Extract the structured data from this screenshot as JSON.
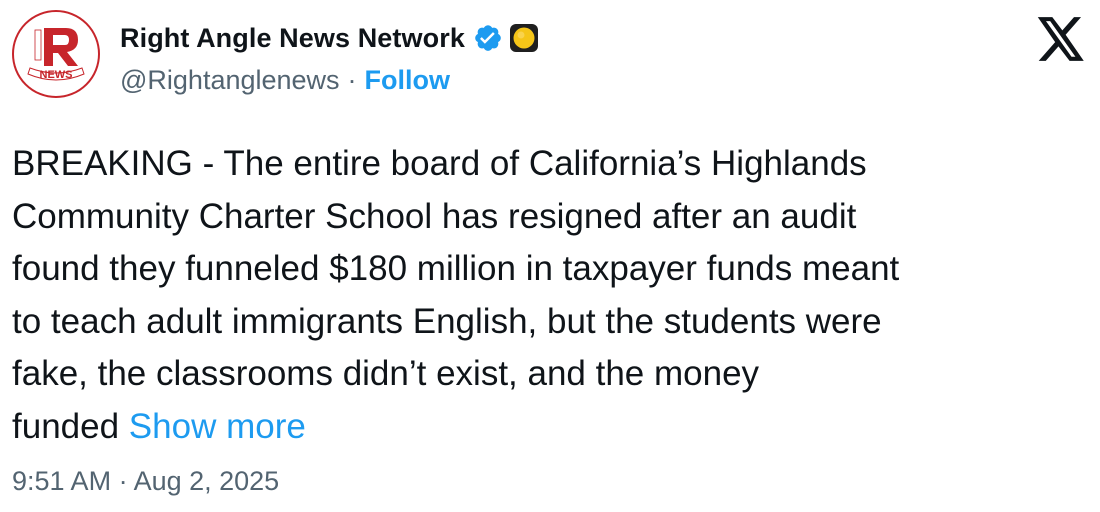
{
  "author": {
    "display_name": "Right Angle News Network",
    "handle": "@Rightanglenews",
    "separator": "·",
    "follow_label": "Follow",
    "verified_icon": "verified-badge-icon",
    "status_emoji": "yellow-circle-emoji",
    "avatar_logo_letters": "RAN NEWS"
  },
  "platform": {
    "logo_icon": "x-logo-icon"
  },
  "tweet": {
    "text": "BREAKING - The entire board of California’s Highlands\nCommunity Charter School has resigned after an audit\nfound they funneled $180 million in taxpayer funds meant\nto teach adult immigrants English, but the students were\nfake, the classrooms didn’t exist, and the money\nfunded",
    "show_more_label": "Show more",
    "timestamp": "9:51 AM · Aug 2, 2025"
  },
  "colors": {
    "link_blue": "#1d9bf0",
    "secondary_gray": "#536471",
    "text_black": "#0f1419",
    "brand_red": "#c7252b"
  }
}
